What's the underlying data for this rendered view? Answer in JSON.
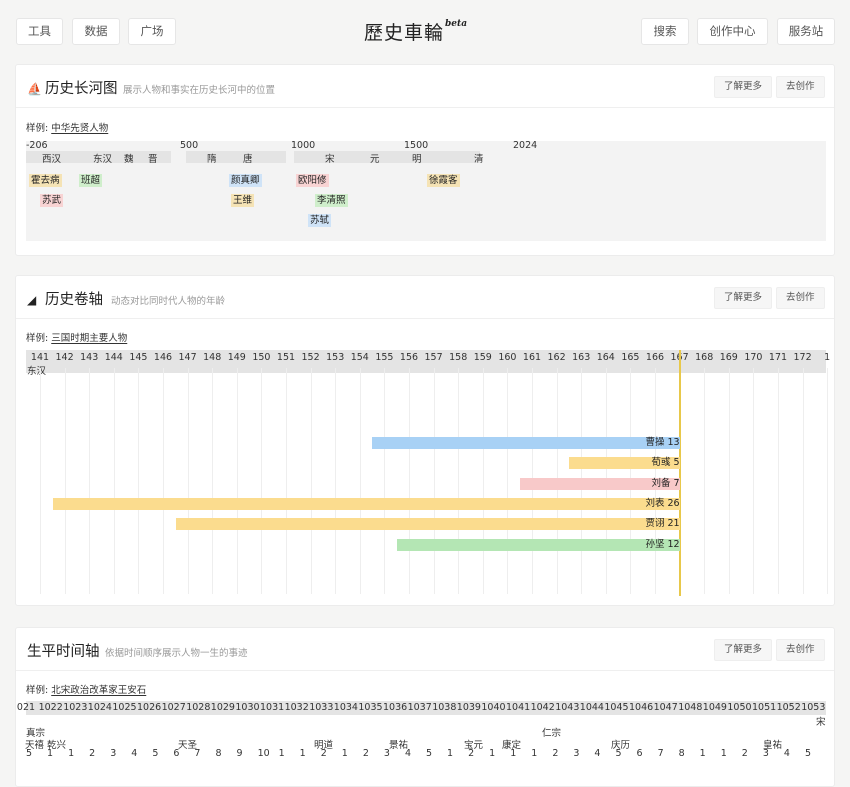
{
  "topbar": {
    "left": [
      "工具",
      "数据",
      "广场"
    ],
    "logo": "歷史車輪",
    "logo_badge": "beta",
    "right": [
      "搜索",
      "创作中心",
      "服务站"
    ]
  },
  "river": {
    "title": "历史长河图",
    "subtitle": "展示人物和事实在历史长河中的位置",
    "btn_more": "了解更多",
    "btn_create": "去创作",
    "sample_label": "样例:",
    "sample_link": "中华先贤人物",
    "years": [
      "-206",
      "500",
      "1000",
      "1500",
      "2024"
    ],
    "dynasties": [
      "西汉",
      "东汉",
      "魏",
      "晋",
      "隋",
      "唐",
      "宋",
      "元",
      "明",
      "清"
    ],
    "people": [
      {
        "name": "霍去病",
        "color": "#f5e3b5"
      },
      {
        "name": "苏武",
        "color": "#f8d3d3"
      },
      {
        "name": "班超",
        "color": "#cfeecb"
      },
      {
        "name": "颜真卿",
        "color": "#cfe3f7"
      },
      {
        "name": "王维",
        "color": "#f5e3b5"
      },
      {
        "name": "欧阳修",
        "color": "#f8d3d3"
      },
      {
        "name": "李清照",
        "color": "#cfeecb"
      },
      {
        "name": "苏轼",
        "color": "#cfe3f7"
      },
      {
        "name": "徐霞客",
        "color": "#f5e3b5"
      }
    ]
  },
  "scroll": {
    "title": "历史卷轴",
    "subtitle": "动态对比同时代人物的年龄",
    "btn_more": "了解更多",
    "btn_create": "去创作",
    "sample_label": "样例:",
    "sample_link": "三国时期主要人物",
    "era_label": "东汉",
    "years": [
      "141",
      "142",
      "143",
      "144",
      "145",
      "146",
      "147",
      "148",
      "149",
      "150",
      "151",
      "152",
      "153",
      "154",
      "155",
      "156",
      "157",
      "158",
      "159",
      "160",
      "161",
      "162",
      "163",
      "164",
      "165",
      "166",
      "167",
      "168",
      "169",
      "170",
      "171",
      "172",
      "1"
    ],
    "current_year": "167",
    "bars": [
      {
        "name": "曹操",
        "age": "13",
        "start": 155,
        "color": "#a8d1f5"
      },
      {
        "name": "荀彧",
        "age": "5",
        "start": 163,
        "color": "#fbdc8e"
      },
      {
        "name": "刘备",
        "age": "7",
        "start": 161,
        "color": "#f8c9c9"
      },
      {
        "name": "刘表",
        "age": "26",
        "start": 142,
        "color": "#fbdc8e"
      },
      {
        "name": "贾诩",
        "age": "21",
        "start": 147,
        "color": "#fbdc8e"
      },
      {
        "name": "孙坚",
        "age": "12",
        "start": 156,
        "color": "#b4e6b4"
      }
    ]
  },
  "life": {
    "title": "生平时间轴",
    "subtitle": "依据时间顺序展示人物一生的事迹",
    "btn_more": "了解更多",
    "btn_create": "去创作",
    "sample_label": "样例:",
    "sample_link": "北宋政治改革家王安石",
    "years": [
      "021",
      "1022",
      "1023",
      "1024",
      "1025",
      "1026",
      "1027",
      "1028",
      "1029",
      "1030",
      "1031",
      "1032",
      "1033",
      "1034",
      "1035",
      "1036",
      "1037",
      "1038",
      "1039",
      "1040",
      "1041",
      "1042",
      "1043",
      "1044",
      "1045",
      "1046",
      "1047",
      "1048",
      "1049",
      "1050",
      "1051",
      "1052",
      "1053"
    ],
    "row1": [
      "真宗",
      "仁宗",
      "宋"
    ],
    "row2": [
      "天禧",
      "乾兴",
      "天圣",
      "明道",
      "景祐",
      "宝元",
      "康定",
      "庆历",
      "皇祐"
    ],
    "row3": [
      "5",
      "1",
      "1",
      "2",
      "3",
      "4",
      "5",
      "6",
      "7",
      "8",
      "9",
      "10",
      "1",
      "1",
      "2",
      "1",
      "2",
      "3",
      "4",
      "5",
      "1",
      "2",
      "1",
      "1",
      "1",
      "2",
      "3",
      "4",
      "5",
      "6",
      "7",
      "8",
      "1",
      "1",
      "2",
      "3",
      "4",
      "5"
    ]
  }
}
